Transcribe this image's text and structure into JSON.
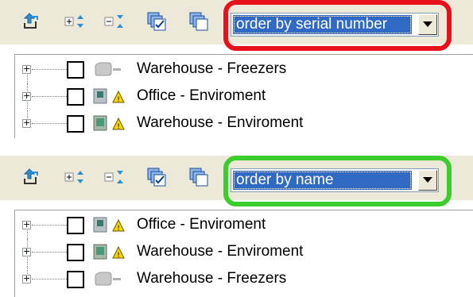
{
  "colors": {
    "top_highlight": "#e8101a",
    "bottom_highlight": "#3bcd2b",
    "selection": "#316ac5"
  },
  "toolbar_icons": [
    "refresh-icon",
    "expand-all-icon",
    "collapse-all-icon",
    "check-all-icon",
    "uncheck-all-icon"
  ],
  "panels": [
    {
      "sort_select": {
        "value": "order by serial number"
      },
      "tree_items": [
        {
          "label": "Warehouse - Freezers",
          "icon": "freezer-sensor-icon"
        },
        {
          "label": "Office - Enviroment",
          "icon": "environment-sensor-icon"
        },
        {
          "label": "Warehouse - Enviroment",
          "icon": "environment-sensor-icon"
        }
      ]
    },
    {
      "sort_select": {
        "value": "order by name"
      },
      "tree_items": [
        {
          "label": "Office - Enviroment",
          "icon": "environment-sensor-icon"
        },
        {
          "label": "Warehouse - Enviroment",
          "icon": "environment-sensor-icon"
        },
        {
          "label": "Warehouse - Freezers",
          "icon": "freezer-sensor-icon"
        }
      ]
    }
  ]
}
